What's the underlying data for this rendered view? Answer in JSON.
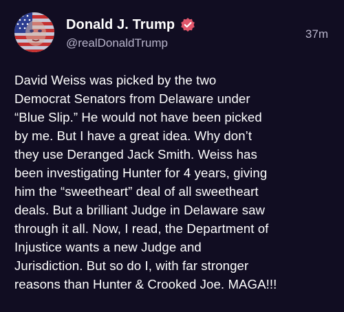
{
  "author": {
    "display_name": "Donald J. Trump",
    "handle": "@realDonaldTrump",
    "verified": true,
    "avatar_icon": "avatar-flag-portrait"
  },
  "post": {
    "time": "37m",
    "text": "David Weiss was picked by the two\nDemocrat Senators from Delaware under\n“Blue Slip.” He would not have been picked\nby me. But I have a great idea. Why don’t\nthey use Deranged Jack Smith. Weiss has\nbeen investigating Hunter for 4 years, giving\nhim the “sweetheart” deal of all sweetheart\ndeals. But a brilliant Judge in Delaware saw\nthrough it all. Now, I read, the Department of\nInjustice wants a new Judge and\nJurisdiction. But so do I, with far stronger\nreasons than Hunter & Crooked Joe. MAGA!!!"
  },
  "colors": {
    "background": "#110d22",
    "verified_badge": "#e0566b",
    "secondary_text": "#b9b5cc"
  }
}
